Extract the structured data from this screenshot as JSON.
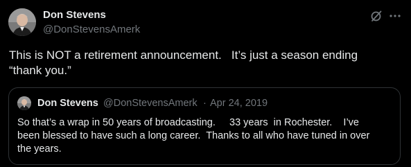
{
  "tweet": {
    "author_name": "Don Stevens",
    "author_handle": "@DonStevensAmerk",
    "text": "This is NOT a retirement announcement.   It’s just a season ending\n“thank you.”",
    "grok_icon": "grok-icon",
    "more_icon": "more-icon"
  },
  "quote": {
    "author_name": "Don Stevens",
    "author_handle": "@DonStevensAmerk",
    "separator": "·",
    "date": "Apr 24, 2019",
    "text": "So that’s a wrap in 50 years of broadcasting.     33 years  in Rochester.    I’ve\nbeen blessed to have such a long career.  Thanks to all who have tuned in over\nthe years."
  },
  "colors": {
    "background": "#000000",
    "primary_text": "#e7e9ea",
    "secondary_text": "#71767b",
    "border": "#2f3336"
  }
}
